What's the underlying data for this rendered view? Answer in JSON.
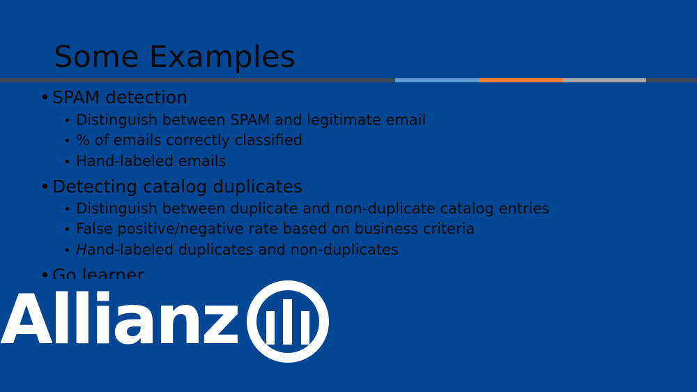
{
  "slide": {
    "title": "Some Examples",
    "bullets": [
      {
        "text": "SPAM detection",
        "sub": [
          "Distinguish between SPAM and legitimate email",
          "% of emails correctly classified",
          "Hand-labeled emails"
        ]
      },
      {
        "text": "Detecting catalog duplicates",
        "sub": [
          "Distinguish between duplicate and non-duplicate catalog entries",
          "False positive/negative rate based on business criteria",
          "and-labeled duplicates and non-duplicates"
        ],
        "third_sub_italic_prefix": "H"
      },
      {
        "text": "Go learner"
      }
    ],
    "bullet_glyph": "•"
  },
  "logo": {
    "wordmark": "Allianz",
    "emblem_icon": "allianz-eagle-emblem-icon"
  },
  "colors": {
    "background": "#034694",
    "text": "#0a0a0a",
    "rule_dark": "#3b4a59",
    "rule_blue": "#5b9bd5",
    "rule_orange": "#ed7d31",
    "rule_gray": "#a5a5a5",
    "logo_white": "#ffffff"
  }
}
